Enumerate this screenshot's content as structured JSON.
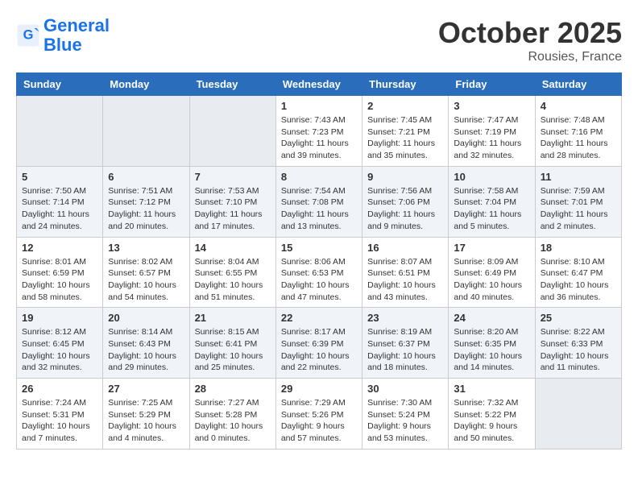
{
  "logo": {
    "line1": "General",
    "line2": "Blue"
  },
  "title": "October 2025",
  "location": "Rousies, France",
  "days_of_week": [
    "Sunday",
    "Monday",
    "Tuesday",
    "Wednesday",
    "Thursday",
    "Friday",
    "Saturday"
  ],
  "weeks": [
    [
      {
        "day": "",
        "info": ""
      },
      {
        "day": "",
        "info": ""
      },
      {
        "day": "",
        "info": ""
      },
      {
        "day": "1",
        "info": "Sunrise: 7:43 AM\nSunset: 7:23 PM\nDaylight: 11 hours and 39 minutes."
      },
      {
        "day": "2",
        "info": "Sunrise: 7:45 AM\nSunset: 7:21 PM\nDaylight: 11 hours and 35 minutes."
      },
      {
        "day": "3",
        "info": "Sunrise: 7:47 AM\nSunset: 7:19 PM\nDaylight: 11 hours and 32 minutes."
      },
      {
        "day": "4",
        "info": "Sunrise: 7:48 AM\nSunset: 7:16 PM\nDaylight: 11 hours and 28 minutes."
      }
    ],
    [
      {
        "day": "5",
        "info": "Sunrise: 7:50 AM\nSunset: 7:14 PM\nDaylight: 11 hours and 24 minutes."
      },
      {
        "day": "6",
        "info": "Sunrise: 7:51 AM\nSunset: 7:12 PM\nDaylight: 11 hours and 20 minutes."
      },
      {
        "day": "7",
        "info": "Sunrise: 7:53 AM\nSunset: 7:10 PM\nDaylight: 11 hours and 17 minutes."
      },
      {
        "day": "8",
        "info": "Sunrise: 7:54 AM\nSunset: 7:08 PM\nDaylight: 11 hours and 13 minutes."
      },
      {
        "day": "9",
        "info": "Sunrise: 7:56 AM\nSunset: 7:06 PM\nDaylight: 11 hours and 9 minutes."
      },
      {
        "day": "10",
        "info": "Sunrise: 7:58 AM\nSunset: 7:04 PM\nDaylight: 11 hours and 5 minutes."
      },
      {
        "day": "11",
        "info": "Sunrise: 7:59 AM\nSunset: 7:01 PM\nDaylight: 11 hours and 2 minutes."
      }
    ],
    [
      {
        "day": "12",
        "info": "Sunrise: 8:01 AM\nSunset: 6:59 PM\nDaylight: 10 hours and 58 minutes."
      },
      {
        "day": "13",
        "info": "Sunrise: 8:02 AM\nSunset: 6:57 PM\nDaylight: 10 hours and 54 minutes."
      },
      {
        "day": "14",
        "info": "Sunrise: 8:04 AM\nSunset: 6:55 PM\nDaylight: 10 hours and 51 minutes."
      },
      {
        "day": "15",
        "info": "Sunrise: 8:06 AM\nSunset: 6:53 PM\nDaylight: 10 hours and 47 minutes."
      },
      {
        "day": "16",
        "info": "Sunrise: 8:07 AM\nSunset: 6:51 PM\nDaylight: 10 hours and 43 minutes."
      },
      {
        "day": "17",
        "info": "Sunrise: 8:09 AM\nSunset: 6:49 PM\nDaylight: 10 hours and 40 minutes."
      },
      {
        "day": "18",
        "info": "Sunrise: 8:10 AM\nSunset: 6:47 PM\nDaylight: 10 hours and 36 minutes."
      }
    ],
    [
      {
        "day": "19",
        "info": "Sunrise: 8:12 AM\nSunset: 6:45 PM\nDaylight: 10 hours and 32 minutes."
      },
      {
        "day": "20",
        "info": "Sunrise: 8:14 AM\nSunset: 6:43 PM\nDaylight: 10 hours and 29 minutes."
      },
      {
        "day": "21",
        "info": "Sunrise: 8:15 AM\nSunset: 6:41 PM\nDaylight: 10 hours and 25 minutes."
      },
      {
        "day": "22",
        "info": "Sunrise: 8:17 AM\nSunset: 6:39 PM\nDaylight: 10 hours and 22 minutes."
      },
      {
        "day": "23",
        "info": "Sunrise: 8:19 AM\nSunset: 6:37 PM\nDaylight: 10 hours and 18 minutes."
      },
      {
        "day": "24",
        "info": "Sunrise: 8:20 AM\nSunset: 6:35 PM\nDaylight: 10 hours and 14 minutes."
      },
      {
        "day": "25",
        "info": "Sunrise: 8:22 AM\nSunset: 6:33 PM\nDaylight: 10 hours and 11 minutes."
      }
    ],
    [
      {
        "day": "26",
        "info": "Sunrise: 7:24 AM\nSunset: 5:31 PM\nDaylight: 10 hours and 7 minutes."
      },
      {
        "day": "27",
        "info": "Sunrise: 7:25 AM\nSunset: 5:29 PM\nDaylight: 10 hours and 4 minutes."
      },
      {
        "day": "28",
        "info": "Sunrise: 7:27 AM\nSunset: 5:28 PM\nDaylight: 10 hours and 0 minutes."
      },
      {
        "day": "29",
        "info": "Sunrise: 7:29 AM\nSunset: 5:26 PM\nDaylight: 9 hours and 57 minutes."
      },
      {
        "day": "30",
        "info": "Sunrise: 7:30 AM\nSunset: 5:24 PM\nDaylight: 9 hours and 53 minutes."
      },
      {
        "day": "31",
        "info": "Sunrise: 7:32 AM\nSunset: 5:22 PM\nDaylight: 9 hours and 50 minutes."
      },
      {
        "day": "",
        "info": ""
      }
    ]
  ]
}
